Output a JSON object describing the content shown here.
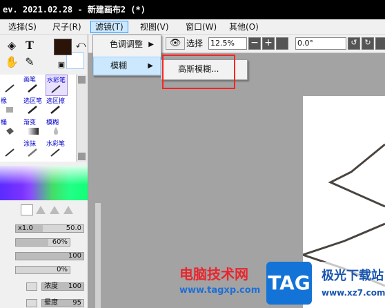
{
  "app": {
    "title": "ev. 2021.02.28 - 新建画布2 (*)"
  },
  "menubar": {
    "items": [
      {
        "label": "选择(S)"
      },
      {
        "label": "尺子(R)"
      },
      {
        "label": "滤镜(T)"
      },
      {
        "label": "视图(V)"
      },
      {
        "label": "窗口(W)"
      },
      {
        "label": "其他(O)"
      }
    ]
  },
  "filter_menu": {
    "items": [
      {
        "label": "色调调整",
        "has_submenu": true
      },
      {
        "label": "模糊",
        "has_submenu": true
      }
    ]
  },
  "blur_submenu": {
    "items": [
      {
        "label": "高斯模糊..."
      }
    ]
  },
  "toolbar": {
    "select_label": "选择",
    "zoom_value": "12.5%",
    "rotation_value": "0.0°"
  },
  "brushes": [
    {
      "label": "",
      "icon": "pen-icon"
    },
    {
      "label": "画笔",
      "icon": "brush-icon"
    },
    {
      "label": "水彩笔",
      "icon": "watercolor-icon"
    },
    {
      "label": "橡",
      "icon": "eraser-icon"
    },
    {
      "label": "选区笔",
      "icon": "selection-pen-icon"
    },
    {
      "label": "选区擦",
      "icon": "selection-eraser-icon"
    },
    {
      "label": "桶",
      "icon": "bucket-icon"
    },
    {
      "label": "渐变",
      "icon": "gradient-icon"
    },
    {
      "label": "模糊",
      "icon": "blur-drop-icon"
    },
    {
      "label": "",
      "icon": "smudge-icon"
    },
    {
      "label": "涂抹",
      "icon": "smudge-brush-icon"
    },
    {
      "label": "水彩笔",
      "icon": "watercolor2-icon"
    }
  ],
  "brush_settings": {
    "size_mult": "x1.0",
    "size_value": "50.0",
    "min_size": "60%",
    "density_value": "100",
    "blend": "0%",
    "density_label": "浓度",
    "density2": "100",
    "dilution_label": "晕度",
    "dilution_value": "95"
  },
  "colors": {
    "fg": "#2a1408",
    "accent_menu": "#cce8ff",
    "highlight_box": "#ff2222"
  },
  "watermark": {
    "title": "电脑技术网",
    "url": "www.tagxp.com",
    "tag": "TAG",
    "download": "极光下载站",
    "url2": "www.xz7.com"
  }
}
